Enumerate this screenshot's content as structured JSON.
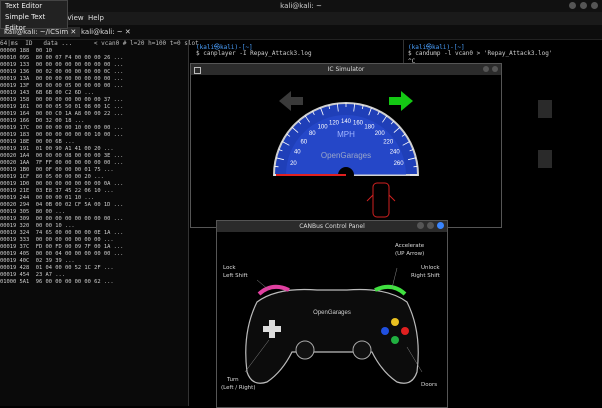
{
  "topbar": {
    "title": "kali@kali: ~"
  },
  "tooltip": {
    "line1": "Text Editor",
    "line2": "Simple Text Editor"
  },
  "menubar": {
    "view": "View",
    "help": "Help"
  },
  "tabs": [
    {
      "label": "kali@kali: ~/ICSim"
    },
    {
      "label": "kali@kali: ~"
    }
  ],
  "left_terminal": {
    "header": "64|ms  ID   data ...      < vcan0 # l=20 h=100 t=0 slot",
    "rows": [
      {
        "a": "00000",
        "id": "188",
        "data": "00 10"
      },
      {
        "a": "00010",
        "id": "095",
        "data": "80 00 07 F4 00 00 00 26 ..."
      },
      {
        "a": "00019",
        "id": "133",
        "data": "00 00 00 00 00 00 00 00 ..."
      },
      {
        "a": "00019",
        "id": "136",
        "data": "00 02 00 00 00 00 00 0C ..."
      },
      {
        "a": "00019",
        "id": "13A",
        "data": "00 00 00 00 00 00 00 00 ..."
      },
      {
        "a": "00019",
        "id": "13F",
        "data": "00 00 00 05 00 00 00 00 ..."
      },
      {
        "a": "00019",
        "id": "143",
        "data": "6B 6B 00 C2 6D ..."
      },
      {
        "a": "00019",
        "id": "158",
        "data": "00 00 00 00 00 00 00 37 ..."
      },
      {
        "a": "00019",
        "id": "161",
        "data": "00 00 05 50 01 08 00 1C ..."
      },
      {
        "a": "00019",
        "id": "164",
        "data": "00 00 C0 1A A8 00 00 22 ..."
      },
      {
        "a": "00019",
        "id": "166",
        "data": "D0 32 00 18 ..."
      },
      {
        "a": "00019",
        "id": "17C",
        "data": "00 00 00 00 10 00 00 00 ..."
      },
      {
        "a": "00019",
        "id": "183",
        "data": "00 00 00 00 00 00 10 00 ..."
      },
      {
        "a": "00019",
        "id": "18E",
        "data": "00 00 6B ..."
      },
      {
        "a": "00019",
        "id": "191",
        "data": "01 00 90 A1 41 00 20 ..."
      },
      {
        "a": "00020",
        "id": "1A4",
        "data": "00 00 00 08 00 00 00 3E ..."
      },
      {
        "a": "00020",
        "id": "1AA",
        "data": "7F FF 00 00 00 00 00 00 ..."
      },
      {
        "a": "00019",
        "id": "1B0",
        "data": "00 0F 00 00 00 01 75 ..."
      },
      {
        "a": "00019",
        "id": "1CF",
        "data": "80 05 00 00 00 20 ..."
      },
      {
        "a": "00019",
        "id": "1D0",
        "data": "00 00 00 00 00 00 00 0A ..."
      },
      {
        "a": "00019",
        "id": "21E",
        "data": "03 E8 37 45 22 06 10 ..."
      },
      {
        "a": "00019",
        "id": "244",
        "data": "00 00 00 01 10 ..."
      },
      {
        "a": "00020",
        "id": "294",
        "data": "04 0B 00 02 CF 5A 00 1D ..."
      },
      {
        "a": "00019",
        "id": "305",
        "data": "80 00 ..."
      },
      {
        "a": "00019",
        "id": "309",
        "data": "00 00 00 00 00 00 00 00 ..."
      },
      {
        "a": "00019",
        "id": "320",
        "data": "00 00 10 ..."
      },
      {
        "a": "00019",
        "id": "324",
        "data": "74 65 00 00 00 00 0E 1A ..."
      },
      {
        "a": "00019",
        "id": "333",
        "data": "00 00 00 00 00 00 00 ..."
      },
      {
        "a": "00019",
        "id": "37C",
        "data": "FD 00 FD 00 09 7F 00 1A ..."
      },
      {
        "a": "00019",
        "id": "405",
        "data": "00 00 04 00 00 00 00 00 ..."
      },
      {
        "a": "00019",
        "id": "40C",
        "data": "02 39 39 ..."
      },
      {
        "a": "00019",
        "id": "428",
        "data": "01 04 00 00 52 1C 2F ..."
      },
      {
        "a": "00019",
        "id": "454",
        "data": "23 A7 ..."
      },
      {
        "a": "01000",
        "id": "5A1",
        "data": "96 00 00 00 00 00 62 ..."
      }
    ]
  },
  "mid_terminal": {
    "prompt": "(kali㉿kali)-[~]",
    "command": "$ canplayer -I Repay_Attack3.log"
  },
  "right_terminal": {
    "prompt": "(kali㉿kali)-[~]",
    "command": "$ candump -l vcan0 > 'Repay_Attack3.log'",
    "ctrl": "^C"
  },
  "ic_sim": {
    "title": "IC Simulator",
    "unit": "MPH",
    "brand": "OpenGarages",
    "speed_ticks": [
      "20",
      "40",
      "60",
      "80",
      "100",
      "120",
      "140",
      "160",
      "180",
      "200",
      "220",
      "240",
      "260"
    ],
    "speed_value": 0
  },
  "can_panel": {
    "title": "CANBus Control Panel",
    "lock": "Lock",
    "left_shift": "Left Shift",
    "accelerate": "Accelerate",
    "up_arrow": "(UP Arrow)",
    "unlock": "Unlock",
    "right_shift": "Right Shift",
    "turn": "Turn",
    "left_right": "(Left / Right)",
    "doors": "Doors",
    "brand": "OpenGarages"
  },
  "colors": {
    "gauge_blue": "#1f3fb8",
    "arrow_green": "#14c814",
    "needle_red": "#e02020"
  }
}
